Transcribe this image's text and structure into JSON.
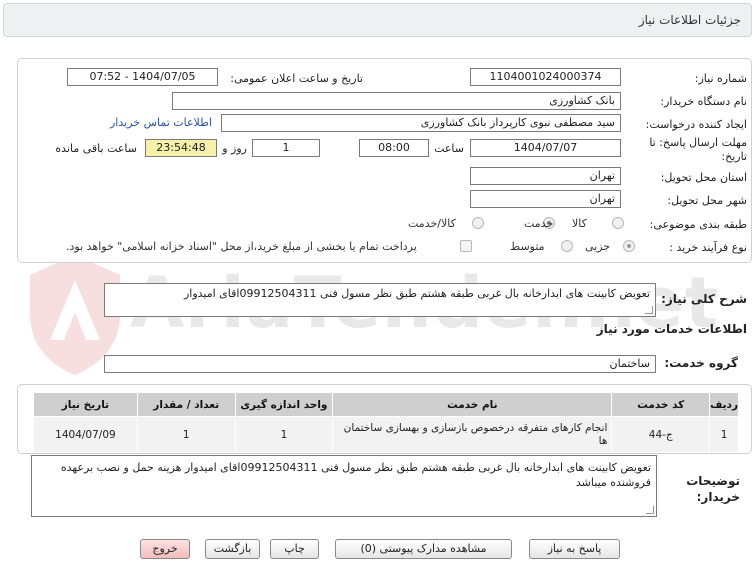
{
  "header": {
    "title": "جزئیات اطلاعات نیاز"
  },
  "form": {
    "need_number_label": "شماره نیاز:",
    "need_number": "1104001024000374",
    "announce_label": "تاریخ و ساعت اعلان عمومی:",
    "announce_value": "1404/07/05 - 07:52",
    "buyer_org_label": "نام دستگاه خریدار:",
    "buyer_org": "بانک کشاورزی",
    "creator_label": "ایجاد کننده درخواست:",
    "creator": "سید مصطفی نبوی کارپرداز بانک کشاورزی",
    "contact_link": "اطلاعات تماس خریدار",
    "deadline_label_1": "مهلت ارسال پاسخ: تا",
    "deadline_label_2": "تاریخ:",
    "deadline_date": "1404/07/07",
    "time_label": "ساعت",
    "deadline_time": "08:00",
    "days_value": "1",
    "days_label": "روز و",
    "remaining_time": "23:54:48",
    "remaining_label": "ساعت باقی مانده",
    "province_label": "استان محل تحویل:",
    "province": "تهران",
    "city_label": "شهر محل تحویل:",
    "city": "تهران",
    "category_label": "طبقه بندی موضوعی:",
    "category_options": [
      "کالا",
      "کالا/خدمت"
    ],
    "category_selected": "خدمت",
    "process_label": "نوع فرآیند خرید :",
    "process_options": [
      "جزیی",
      "متوسط"
    ],
    "payment_note": "پرداخت تمام یا بخشی از مبلغ خرید،از محل \"اسناد خزانه اسلامی\" خواهد بود."
  },
  "summary": {
    "label": "شرح کلی نیاز:",
    "text": "تعویض کابینت های ابدارخانه بال غربی طبقه هشتم طبق نظر مسول فنی 09912504311اقای امیدوار"
  },
  "services": {
    "title": "اطلاعات خدمات مورد نیاز",
    "group_label": "گروه خدمت:",
    "group_value": "ساختمان",
    "columns": [
      "ردیف",
      "کد خدمت",
      "نام خدمت",
      "واحد اندازه گیری",
      "تعداد / مقدار",
      "تاریخ نیاز"
    ],
    "rows": [
      {
        "row": "1",
        "code": "ج-44",
        "name": "انجام کارهای متفرقه درخصوص بازسازی و بهسازی ساختمان ها",
        "unit": "1",
        "qty": "1",
        "date": "1404/07/09"
      }
    ]
  },
  "buyer_notes": {
    "label_1": "توضیحات",
    "label_2": "خریدار:",
    "text": "تعویض کابینت های ابدارخانه بال غربی طبقه هشتم طبق نظر مسول فنی 09912504311اقای امیدوار هزینه حمل و نصب برعهده فروشنده میباشد"
  },
  "buttons": {
    "reply": "پاسخ به نیاز",
    "attachments": "مشاهده مدارک پیوستی (0)",
    "print": "چاپ",
    "back": "بازگشت",
    "exit": "خروج"
  },
  "watermark": "AriaTender.net",
  "colors": {
    "remaining_bg": "#f6f1a8",
    "link": "#2a52a8",
    "exit_bg": "#f2bcbc"
  }
}
